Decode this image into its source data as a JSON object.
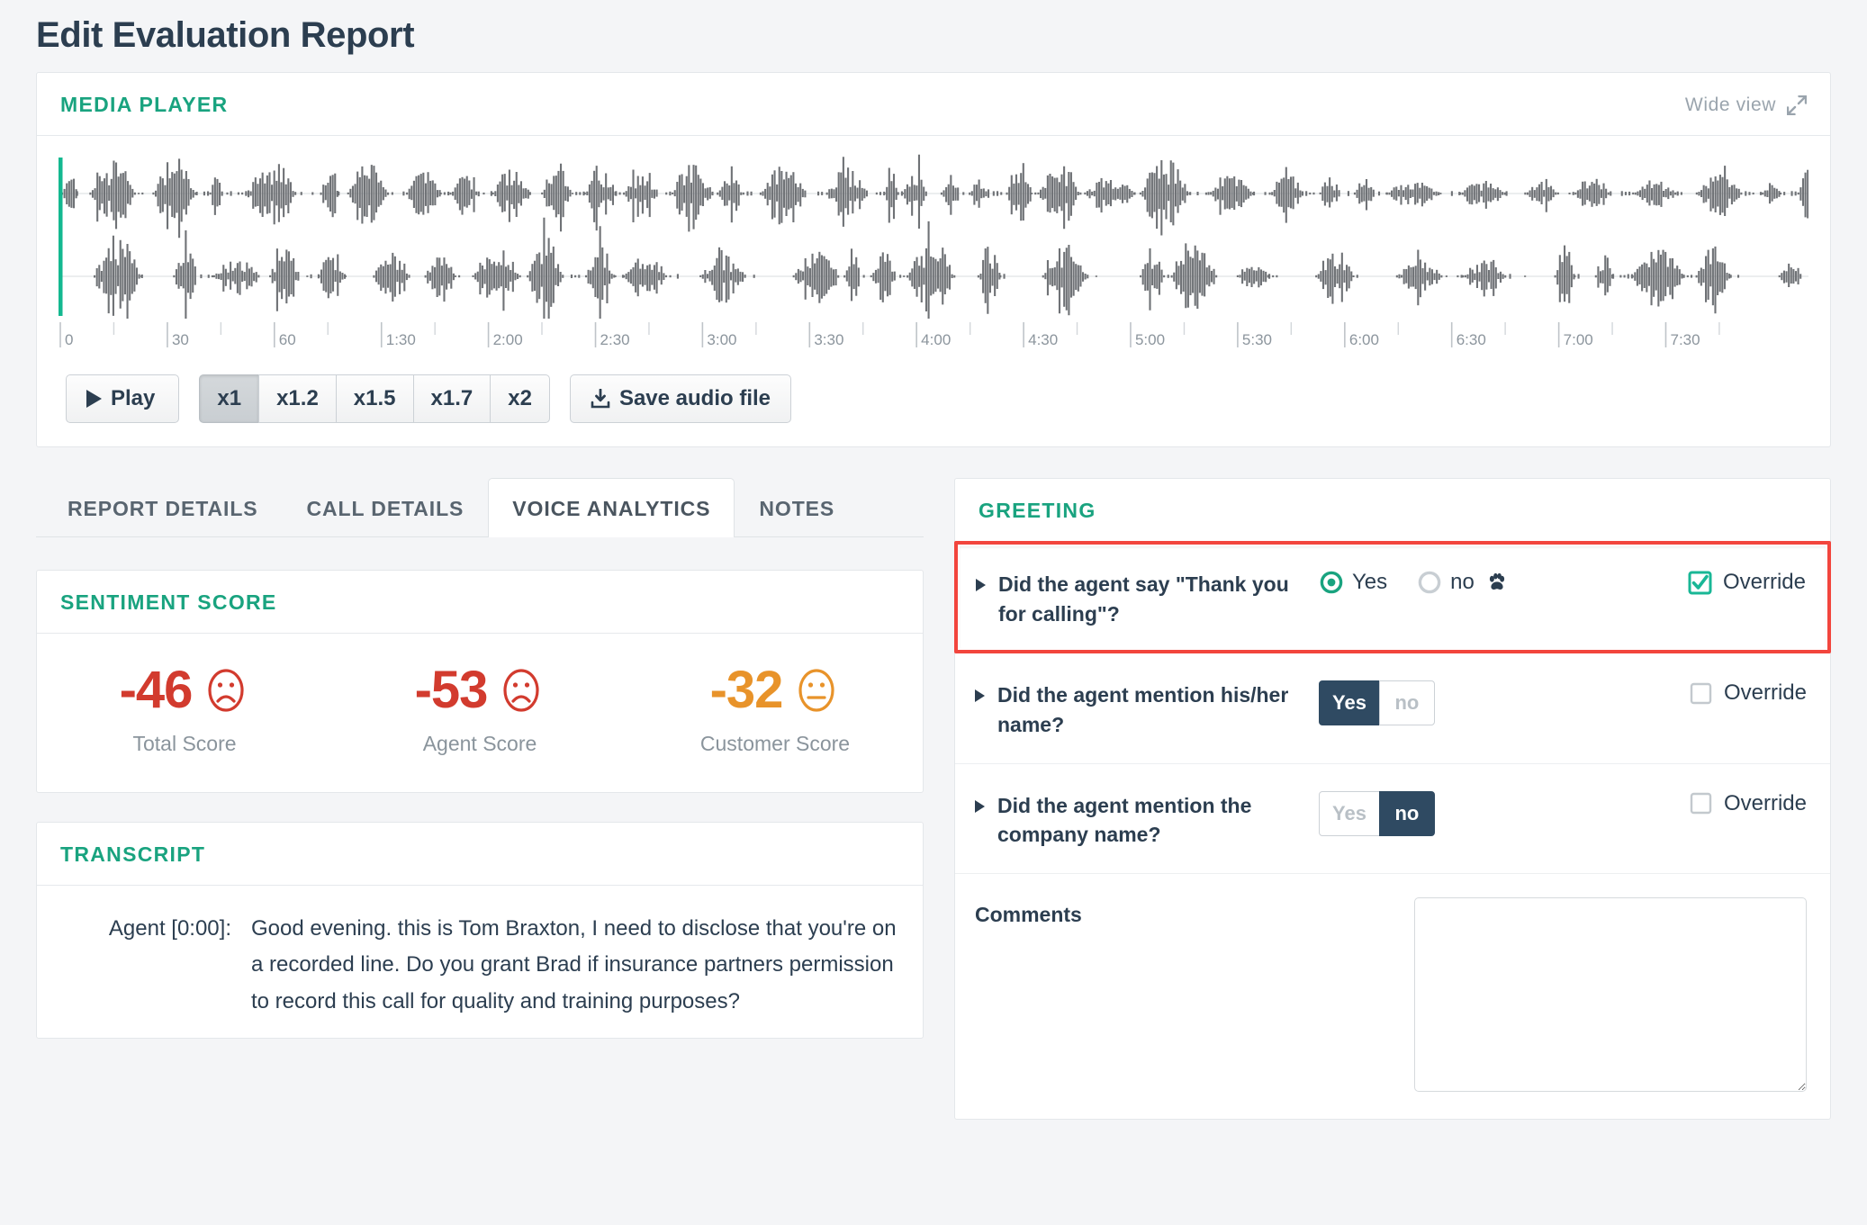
{
  "page": {
    "title": "Edit Evaluation Report"
  },
  "media_player": {
    "title": "MEDIA PLAYER",
    "wide_view_label": "Wide view",
    "wide_view_icon": "expand-arrows-icon",
    "timeline_ticks": [
      "0",
      "30",
      "60",
      "1:30",
      "2:00",
      "2:30",
      "3:00",
      "3:30",
      "4:00",
      "4:30",
      "5:00",
      "5:30",
      "6:00",
      "6:30",
      "7:00",
      "7:30"
    ],
    "playhead_position_label": "0",
    "controls": {
      "play_label": "Play",
      "play_icon": "play-triangle-icon",
      "speeds": [
        {
          "label": "x1",
          "active": true
        },
        {
          "label": "x1.2",
          "active": false
        },
        {
          "label": "x1.5",
          "active": false
        },
        {
          "label": "x1.7",
          "active": false
        },
        {
          "label": "x2",
          "active": false
        }
      ],
      "save_label": "Save audio file",
      "save_icon": "download-icon"
    }
  },
  "tabs": [
    {
      "label": "REPORT DETAILS",
      "active": false
    },
    {
      "label": "CALL DETAILS",
      "active": false
    },
    {
      "label": "VOICE ANALYTICS",
      "active": true
    },
    {
      "label": "NOTES",
      "active": false
    }
  ],
  "sentiment": {
    "title": "SENTIMENT SCORE",
    "scores": [
      {
        "value": "-46",
        "label": "Total Score",
        "face": "frown-icon",
        "color": "#d23b2e"
      },
      {
        "value": "-53",
        "label": "Agent Score",
        "face": "frown-icon",
        "color": "#d23b2e"
      },
      {
        "value": "-32",
        "label": "Customer Score",
        "face": "neutral-icon",
        "color": "#e8932a"
      }
    ]
  },
  "transcript": {
    "title": "TRANSCRIPT",
    "lines": [
      {
        "speaker": "Agent [0:00]:",
        "text": "Good evening. this is Tom Braxton, I need to disclose that you're on a recorded line. Do you grant Brad if insurance partners permission to record this call for quality and training purposes?"
      }
    ]
  },
  "greeting": {
    "title": "GREETING",
    "questions": [
      {
        "text": "Did the agent say \"Thank you for calling\"?",
        "control": "radio",
        "highlighted": true,
        "options": [
          {
            "label": "Yes",
            "selected": true
          },
          {
            "label": "no",
            "selected": false,
            "icon": "paw-icon"
          }
        ],
        "override_label": "Override",
        "override_checked": true
      },
      {
        "text": "Did the agent mention his/her name?",
        "control": "toggle",
        "highlighted": false,
        "options": [
          {
            "label": "Yes",
            "selected": true
          },
          {
            "label": "no",
            "selected": false
          }
        ],
        "override_label": "Override",
        "override_checked": false
      },
      {
        "text": "Did the agent mention the company name?",
        "control": "toggle",
        "highlighted": false,
        "options": [
          {
            "label": "Yes",
            "selected": false
          },
          {
            "label": "no",
            "selected": true
          }
        ],
        "override_label": "Override",
        "override_checked": false
      }
    ],
    "comments_label": "Comments",
    "comments_value": "",
    "comments_placeholder": ""
  },
  "colors": {
    "accent_teal": "#19a37f",
    "highlight_red": "#f2453d",
    "toggle_navy": "#2f4a62",
    "negative_red": "#d23b2e",
    "warning_orange": "#e8932a",
    "page_bg": "#f4f5f7",
    "waveform": "#6f7276",
    "playhead": "#14b890"
  }
}
